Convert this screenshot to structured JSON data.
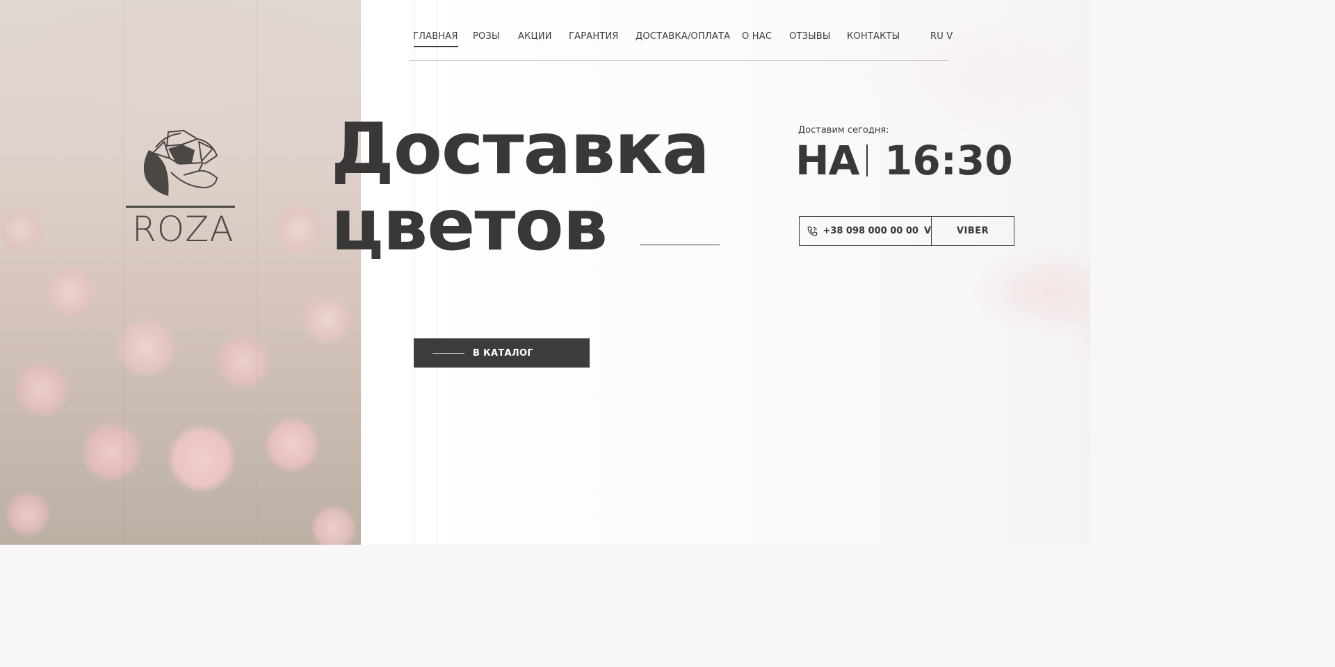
{
  "brand": {
    "name": "ROZA",
    "logo_icon": "rose-logo-icon"
  },
  "nav": {
    "items": [
      {
        "label": "ГЛАВНАЯ",
        "active": true
      },
      {
        "label": "РОЗЫ"
      },
      {
        "label": "АКЦИИ"
      },
      {
        "label": "ГАРАНТИЯ"
      },
      {
        "label": "ДОСТАВКА/ОПЛАТА"
      },
      {
        "label": "О НАС"
      },
      {
        "label": "ОТЗЫВЫ"
      },
      {
        "label": "КОНТАКТЫ"
      }
    ],
    "language": "RU V"
  },
  "hero": {
    "line1": "Доставка",
    "line2": "цветов"
  },
  "delivery": {
    "label": "Доставим сегодня:",
    "prefix": "НА",
    "time": "16:30"
  },
  "contact": {
    "phone": "+38 098 000 00 00",
    "phone_caret": "V",
    "phone_icon": "phone-icon",
    "viber_label": "VIBER"
  },
  "cta": {
    "catalog_label": "В КАТАЛОГ"
  },
  "colors": {
    "text": "#393837",
    "button_bg": "#3e3c3b",
    "button_text": "#ffffff"
  }
}
